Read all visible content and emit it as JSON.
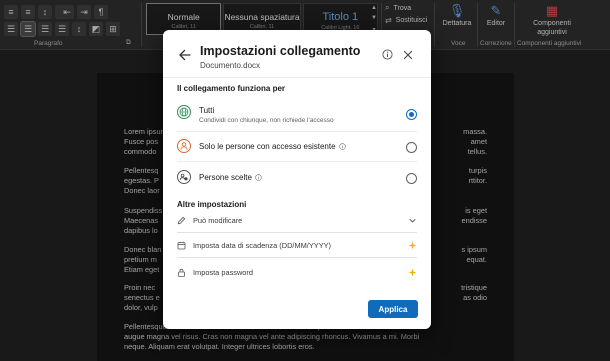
{
  "ribbon": {
    "paragraph_label": "Paragrafo",
    "styles": [
      {
        "name": "Normale",
        "font": "Calibri, 11"
      },
      {
        "name": "Nessuna spaziatura",
        "font": "Calibri, 11"
      },
      {
        "name": "Titolo 1",
        "font": "Calibri Light, 16"
      }
    ],
    "find_label": "Trova",
    "replace_label": "Sostituisci",
    "dictation_label": "Dettatura",
    "voice_label": "Voce",
    "editor_label": "Editor",
    "correction_label": "Correzione",
    "addins_label_1": "Componenti",
    "addins_label_2": "aggiuntivi",
    "addins_group_label": "Componenti aggiuntivi",
    "accent": "#6aa9e6"
  },
  "document": {
    "paragraphs": [
      {
        "left": [
          "Lorem ipsum",
          "Fusce pos",
          "commodo"
        ],
        "right": [
          "massa.",
          "amet",
          "tellus."
        ]
      },
      {
        "left": [
          "Pellentesq",
          "egestas. P",
          "Donec laor"
        ],
        "right": [
          "turpis",
          "rttitor.",
          ""
        ]
      },
      {
        "left": [
          "Suspendiss",
          "Maecenas",
          "dapibus lo"
        ],
        "right": [
          "is eget",
          "endisse",
          ""
        ]
      },
      {
        "left": [
          "Donec blan",
          "pretium m",
          "Etiam eget"
        ],
        "right": [
          "s ipsum",
          "equat.",
          ""
        ]
      },
      {
        "left": [
          "Proin nec",
          "senectus e",
          "dolor, vulp"
        ],
        "right": [
          "tristique",
          "as odio",
          ""
        ]
      },
      {
        "full": [
          "Pellentesque ... ... ... ... ... ... ... ... ... ... ... ... ... ... ... ... ... vulputate",
          "augue magna vel risus. Cras non magna vel ante adipiscing rhoncus. Vivamus a mi. Morbi",
          "neque. Aliquam erat volutpat. Integer ultrices lobortis eros."
        ]
      }
    ]
  },
  "dialog": {
    "title": "Impostazioni collegamento",
    "filename": "Documento.docx",
    "section_link_works_for": "Il collegamento funziona per",
    "options": [
      {
        "label": "Tutti",
        "sub": "Condividi con chiunque, non richiede l'accesso",
        "icon": "globe-icon",
        "selected": true,
        "info": false
      },
      {
        "label": "Solo le persone con accesso esistente",
        "sub": "",
        "icon": "person-icon",
        "selected": false,
        "info": true
      },
      {
        "label": "Persone scelte",
        "sub": "",
        "icon": "people-icon",
        "selected": false,
        "info": true
      }
    ],
    "section_other": "Altre impostazioni",
    "settings": [
      {
        "label": "Può modificare",
        "icon": "pencil-icon",
        "end": "chevron-down-icon"
      },
      {
        "label": "Imposta data di scadenza (DD/MM/YYYY)",
        "icon": "calendar-icon",
        "end": "premium-sparkle-icon"
      },
      {
        "label": "Imposta password",
        "icon": "lock-icon",
        "end": "premium-sparkle-icon"
      }
    ],
    "apply_label": "Applica",
    "accent": "#0f6cbd",
    "premium_color": "#f2b300"
  }
}
